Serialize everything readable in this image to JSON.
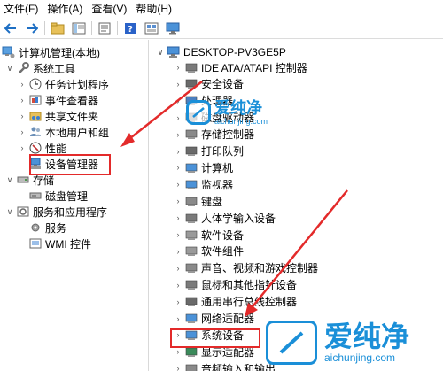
{
  "menu": [
    "文件(F)",
    "操作(A)",
    "查看(V)",
    "帮助(H)"
  ],
  "toolbar_icons": [
    "back-icon",
    "forward-icon",
    "folder-up-icon",
    "console-tree-icon",
    "properties-icon",
    "help-icon",
    "view-icon",
    "monitor-icon"
  ],
  "left_tree": {
    "root": "计算机管理(本地)",
    "system_tools": "系统工具",
    "task_scheduler": "任务计划程序",
    "event_viewer": "事件查看器",
    "shared_folders": "共享文件夹",
    "local_users": "本地用户和组",
    "performance": "性能",
    "device_manager": "设备管理器",
    "storage": "存储",
    "disk_management": "磁盘管理",
    "services_apps": "服务和应用程序",
    "services": "服务",
    "wmi": "WMI 控件"
  },
  "right_tree": {
    "computer_name": "DESKTOP-PV3GE5P",
    "items": [
      "IDE ATA/ATAPI 控制器",
      "安全设备",
      "处理器",
      "磁盘驱动器",
      "存储控制器",
      "打印队列",
      "计算机",
      "监视器",
      "键盘",
      "人体学输入设备",
      "软件设备",
      "软件组件",
      "声音、视频和游戏控制器",
      "鼠标和其他指针设备",
      "通用串行总线控制器",
      "网络适配器",
      "系统设备",
      "显示适配器",
      "音频输入和输出"
    ]
  },
  "watermark": {
    "text": "爱纯净",
    "url": "aichunjing.com"
  },
  "colors": {
    "highlight_red": "#e32a2a",
    "watermark_blue": "#1a8fd8"
  }
}
